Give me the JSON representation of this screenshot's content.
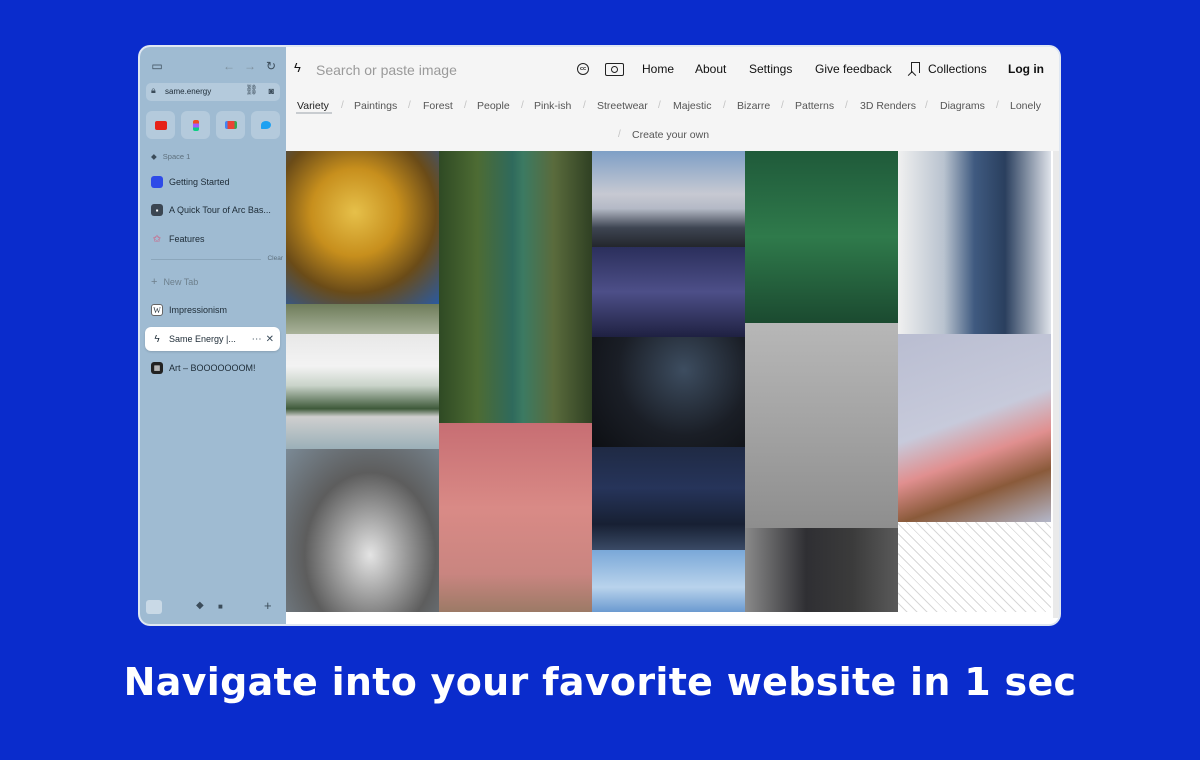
{
  "sidebar": {
    "url": "same.energy",
    "space_label": "Space 1",
    "pinned_tabs": [
      {
        "label": "Getting Started",
        "icon": "square-blue-icon"
      },
      {
        "label": "A Quick Tour of Arc Bas...",
        "icon": "arc-tour-icon"
      },
      {
        "label": "Features",
        "icon": "star-outline-icon"
      }
    ],
    "clear_label": "Clear",
    "new_tab_label": "New Tab",
    "tabs": [
      {
        "label": "Impressionism",
        "icon": "wikipedia-icon"
      },
      {
        "label": "Same Energy |...",
        "icon": "bolt-icon",
        "active": true
      },
      {
        "label": "Art – BOOOOOOOM!",
        "icon": "booooooom-icon"
      }
    ],
    "favorites": [
      {
        "name": "youtube-icon",
        "color": "#e62117"
      },
      {
        "name": "figma-icon",
        "color": "#f24e1e"
      },
      {
        "name": "gmail-icon",
        "color": "#ea4335"
      },
      {
        "name": "twitter-icon",
        "color": "#1da1f2"
      }
    ]
  },
  "topbar": {
    "search_placeholder": "Search or paste image",
    "nav": {
      "home": "Home",
      "about": "About",
      "settings": "Settings",
      "feedback": "Give feedback",
      "collections": "Collections",
      "login": "Log in"
    },
    "cc_label": "cc"
  },
  "categories": [
    "Variety",
    "Paintings",
    "Forest",
    "People",
    "Pink-ish",
    "Streetwear",
    "Majestic",
    "Bizarre",
    "Patterns",
    "3D Renders",
    "Diagrams",
    "Lonely",
    "Create your own"
  ],
  "active_category": "Variety",
  "caption": "Navigate into your favorite website in 1 sec",
  "colors": {
    "background": "#0a2ccc",
    "sidebar": "#9fbbd2"
  }
}
